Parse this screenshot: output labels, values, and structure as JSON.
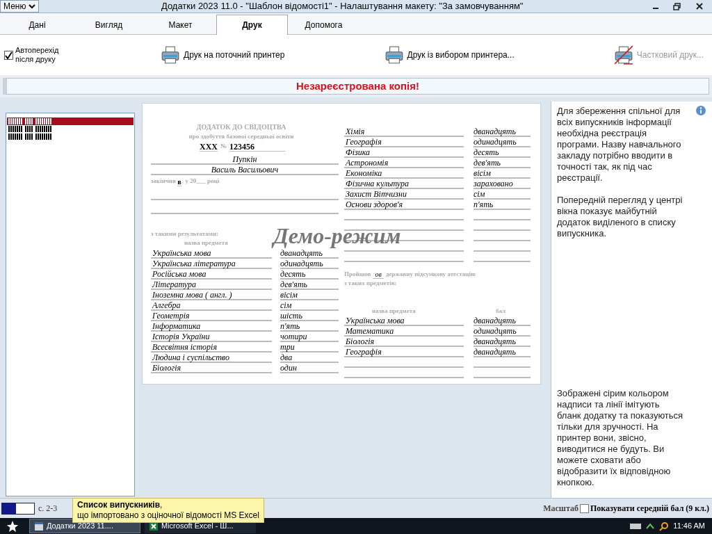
{
  "menu_button": {
    "label": "Меню"
  },
  "window": {
    "title": "Додатки 2023 11.0 - \"Шаблон відомості1\" - Налаштування макету: \"За замовчуванням\""
  },
  "tabs": [
    {
      "label": "Дані",
      "selected": false
    },
    {
      "label": "Вигляд",
      "selected": false
    },
    {
      "label": "Макет",
      "selected": false
    },
    {
      "label": "Друк",
      "selected": true
    },
    {
      "label": "Допомога",
      "selected": false
    }
  ],
  "toolbar": {
    "auto_advance": {
      "label": "Автоперехід після друку",
      "checked": true
    },
    "actions": [
      {
        "label": "Друк на поточний принтер",
        "disabled": false
      },
      {
        "label": "Друк із вибором принтера...",
        "disabled": false
      },
      {
        "label": "Частковий друк...",
        "disabled": true
      }
    ]
  },
  "banner": "Незареєстрована копія!",
  "graduates_list": {
    "items": [
      {
        "selected": true
      },
      {
        "selected": false
      },
      {
        "selected": false
      }
    ]
  },
  "document": {
    "heading": "ДОДАТОК ДО СВІДОЦТВА",
    "subheading": "про здобуття базової середньої освіти",
    "series": "XXX",
    "number_label": "№",
    "number": "123456",
    "surname": "Пупкін",
    "given_names": "Василь Васильович",
    "finished_label": "закінчив",
    "finished_value": "в",
    "year_label": "у 20___ році",
    "results_label": "з такими результатами:",
    "subject_label": "назва предмета",
    "watermark": "Демо-режим",
    "grades_left": [
      {
        "subject": "Українська мова",
        "grade": "дванадцять"
      },
      {
        "subject": "Українська література",
        "grade": "одинадцять"
      },
      {
        "subject": "Російська мова",
        "grade": "десять"
      },
      {
        "subject": "Література",
        "grade": "дев'ять"
      },
      {
        "subject": "Іноземна мова ( англ. )",
        "grade": "вісім"
      },
      {
        "subject": "Алгебра",
        "grade": "сім"
      },
      {
        "subject": "Геометрія",
        "grade": "шість"
      },
      {
        "subject": "Інформатика",
        "grade": "п'ять"
      },
      {
        "subject": "Історія України",
        "grade": "чотири"
      },
      {
        "subject": "Всесвітня історія",
        "grade": "три"
      },
      {
        "subject": "Людина і суспільство",
        "grade": "два"
      },
      {
        "subject": "Біологія",
        "grade": "один"
      }
    ],
    "grades_right": [
      {
        "subject": "Хімія",
        "grade": "дванадцять"
      },
      {
        "subject": "Географія",
        "grade": "одинадцять"
      },
      {
        "subject": "Фізика",
        "grade": "десять"
      },
      {
        "subject": "Астрономія",
        "grade": "дев'ять"
      },
      {
        "subject": "Економіка",
        "grade": "вісім"
      },
      {
        "subject": "Фізична культура",
        "grade": "зараховано"
      },
      {
        "subject": "Захист Вітчизни",
        "grade": "сім"
      },
      {
        "subject": "Основи здоров'я",
        "grade": "п'ять"
      }
    ],
    "exam_intro_before": "Пройшов",
    "exam_intro_value": "ов",
    "exam_intro_after": "державну підсумкову атестацію",
    "exam_intro_line2": "з таких предметів:",
    "exam_subject_label": "назва предмета",
    "exam_grade_label": "бал",
    "exam_grades": [
      {
        "subject": "Українська мова",
        "grade": "дванадцять"
      },
      {
        "subject": "Математика",
        "grade": "одинадцять"
      },
      {
        "subject": "Біологія",
        "grade": "дванадцять"
      },
      {
        "subject": "Географія",
        "grade": "дванадцять"
      }
    ]
  },
  "info_panel": {
    "top_text": "Для збереження спільної для всіх випускників інформації необхідна реєстрація програми. Назву навчального закладу потрібно вводити в точності так, як під час реєстрації.\n\nПопередній перегляд у центрі вікна показує майбутній додаток виділеного в списку випускника.",
    "bottom_text": "Зображені сірим кольором надписи та лінії імітують бланк додатку та показуються тільки для зручності. На принтер вони, звісно, виводитися не будуть. Ви можете сховати або відобразити їх відповідною кнопкою."
  },
  "status_bar": {
    "page": "с. 2-3",
    "zoom_label": "Масштаб",
    "show_average": {
      "label": "Показувати середній бал (9 кл.)",
      "checked": false
    }
  },
  "tooltip": {
    "lines": [
      "**Список випускників**,",
      "що імпортовано з оціночної відомості MS Excel"
    ]
  },
  "taskbar": {
    "buttons": [
      {
        "label": "Додатки 2023 11....",
        "selected": true
      },
      {
        "label": "Microsoft Excel - Ш...",
        "selected": false
      }
    ],
    "clock": "11:46 AM"
  }
}
